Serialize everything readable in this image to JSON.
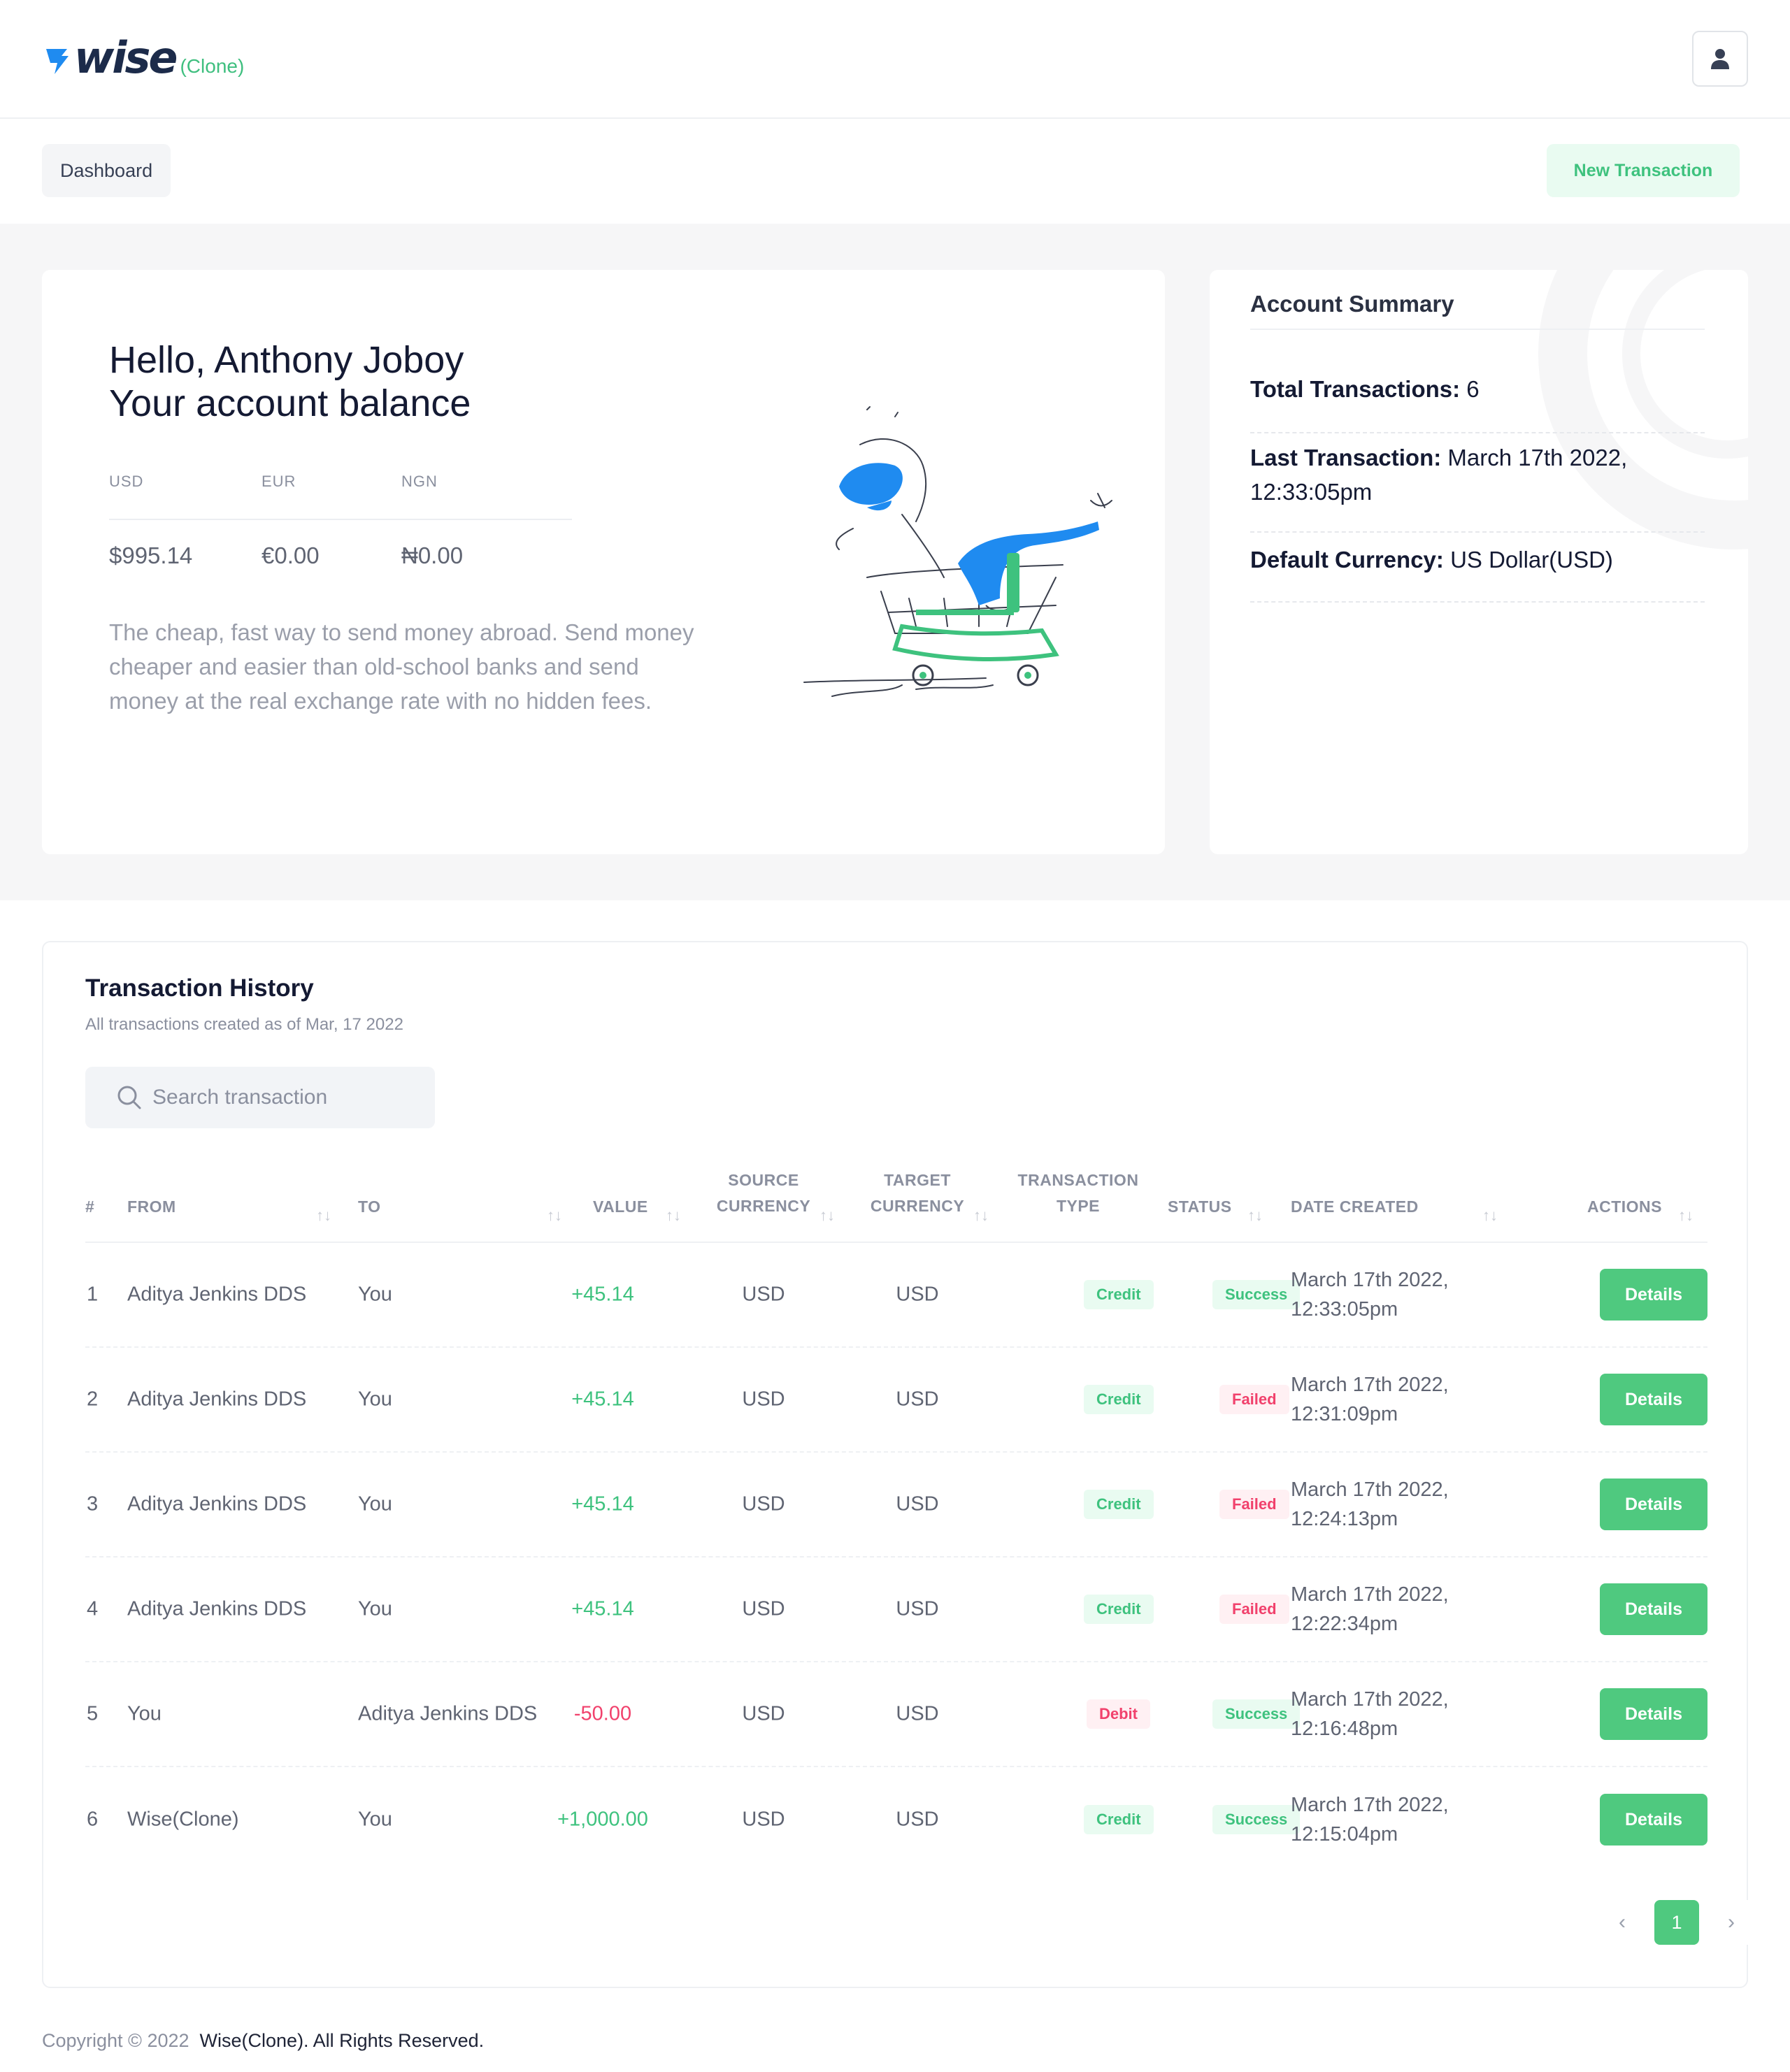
{
  "app": {
    "logo_text": "wise",
    "logo_suffix": "(Clone)"
  },
  "nav": {
    "dashboard_label": "Dashboard",
    "new_transaction_label": "New Transaction"
  },
  "hero": {
    "greeting": "Hello, Anthony Joboy",
    "balance_title": "Your account balance",
    "balances": [
      {
        "currency": "USD",
        "amount": "$995.14"
      },
      {
        "currency": "EUR",
        "amount": "€0.00"
      },
      {
        "currency": "NGN",
        "amount": "₦0.00"
      }
    ],
    "description": "The cheap, fast way to send money abroad. Send money cheaper and easier than old-school banks and send money at the real exchange rate with no hidden fees."
  },
  "summary": {
    "title": "Account Summary",
    "total_label": "Total Transactions:",
    "total_value": "6",
    "last_label": "Last Transaction:",
    "last_value": "March 17th 2022, 12:33:05pm",
    "default_label": "Default Currency:",
    "default_value": "US Dollar(USD)"
  },
  "transactions": {
    "title": "Transaction History",
    "subtitle": "All transactions created as of Mar, 17 2022",
    "search_placeholder": "Search transaction",
    "columns": {
      "num": "#",
      "from": "FROM",
      "to": "TO",
      "value": "VALUE",
      "source_1": "SOURCE",
      "source_2": "CURRENCY",
      "target_1": "TARGET",
      "target_2": "CURRENCY",
      "type_1": "TRANSACTION",
      "type_2": "TYPE",
      "status": "STATUS",
      "date": "DATE CREATED",
      "actions": "ACTIONS"
    },
    "sort_glyph": "↑↓",
    "details_label": "Details",
    "rows": [
      {
        "num": "1",
        "from": "Aditya Jenkins DDS",
        "to": "You",
        "value": "+45.14",
        "sign": "pos",
        "source": "USD",
        "target": "USD",
        "type": "Credit",
        "status": "Success",
        "date_1": "March 17th 2022,",
        "date_2": "12:33:05pm"
      },
      {
        "num": "2",
        "from": "Aditya Jenkins DDS",
        "to": "You",
        "value": "+45.14",
        "sign": "pos",
        "source": "USD",
        "target": "USD",
        "type": "Credit",
        "status": "Failed",
        "date_1": "March 17th 2022,",
        "date_2": "12:31:09pm"
      },
      {
        "num": "3",
        "from": "Aditya Jenkins DDS",
        "to": "You",
        "value": "+45.14",
        "sign": "pos",
        "source": "USD",
        "target": "USD",
        "type": "Credit",
        "status": "Failed",
        "date_1": "March 17th 2022,",
        "date_2": "12:24:13pm"
      },
      {
        "num": "4",
        "from": "Aditya Jenkins DDS",
        "to": "You",
        "value": "+45.14",
        "sign": "pos",
        "source": "USD",
        "target": "USD",
        "type": "Credit",
        "status": "Failed",
        "date_1": "March 17th 2022,",
        "date_2": "12:22:34pm"
      },
      {
        "num": "5",
        "from": "You",
        "to": "Aditya Jenkins DDS",
        "value": "-50.00",
        "sign": "neg",
        "source": "USD",
        "target": "USD",
        "type": "Debit",
        "status": "Success",
        "date_1": "March 17th 2022,",
        "date_2": "12:16:48pm"
      },
      {
        "num": "6",
        "from": "Wise(Clone)",
        "to": "You",
        "value": "+1,000.00",
        "sign": "pos",
        "source": "USD",
        "target": "USD",
        "type": "Credit",
        "status": "Success",
        "date_1": "March 17th 2022,",
        "date_2": "12:15:04pm"
      }
    ],
    "pagination": {
      "prev": "‹",
      "current": "1",
      "next": "›"
    }
  },
  "footer": {
    "copyright": "Copyright © 2022",
    "brand": "Wise(Clone). All Rights Reserved."
  },
  "colors": {
    "accent_green": "#4fc97f",
    "danger_red": "#f1416c",
    "brand_blue": "#1c2b4a",
    "illustration_blue": "#1f8bf0"
  },
  "icons": {
    "user": "user-icon",
    "search": "search-icon",
    "sort": "sort-icon",
    "prev": "chevron-left-icon",
    "next": "chevron-right-icon"
  }
}
